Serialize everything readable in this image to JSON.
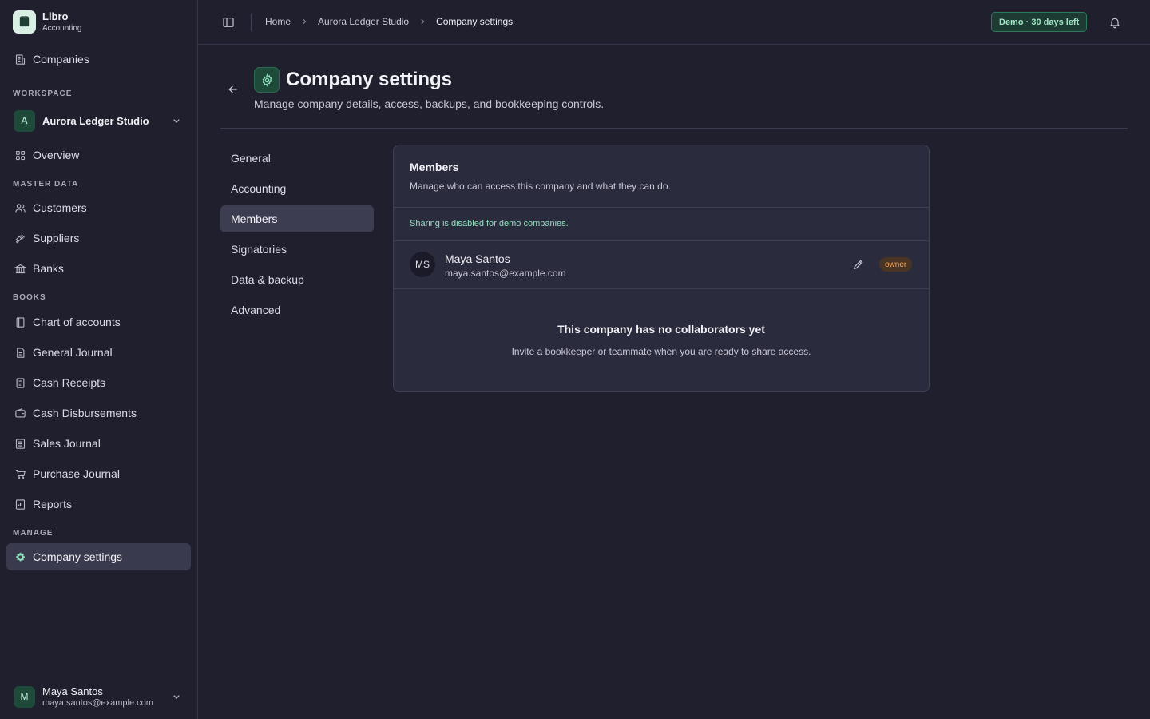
{
  "brand": {
    "name": "Libro",
    "subtitle": "Accounting"
  },
  "sidebar": {
    "companies_label": "Companies",
    "sections": {
      "workspace": "WORKSPACE",
      "master_data": "MASTER DATA",
      "books": "BOOKS",
      "manage": "MANAGE"
    },
    "workspace": {
      "initial": "A",
      "name": "Aurora Ledger Studio"
    },
    "items": [
      {
        "label": "Overview",
        "icon": "grid-icon"
      },
      {
        "label": "Customers",
        "icon": "users-icon"
      },
      {
        "label": "Suppliers",
        "icon": "truck-icon"
      },
      {
        "label": "Banks",
        "icon": "bank-icon"
      },
      {
        "label": "Chart of accounts",
        "icon": "book-icon"
      },
      {
        "label": "General Journal",
        "icon": "journal-icon"
      },
      {
        "label": "Cash Receipts",
        "icon": "receipt-icon"
      },
      {
        "label": "Cash Disbursements",
        "icon": "wallet-icon"
      },
      {
        "label": "Sales Journal",
        "icon": "list-icon"
      },
      {
        "label": "Purchase Journal",
        "icon": "cart-icon"
      },
      {
        "label": "Reports",
        "icon": "chart-icon"
      },
      {
        "label": "Company settings",
        "icon": "gear-icon"
      }
    ],
    "user": {
      "initial": "M",
      "name": "Maya Santos",
      "email": "maya.santos@example.com"
    }
  },
  "topbar": {
    "breadcrumbs": [
      "Home",
      "Aurora Ledger Studio",
      "Company settings"
    ],
    "demo_badge": "Demo · 30 days left"
  },
  "page": {
    "title": "Company settings",
    "subtitle": "Manage company details, access, backups, and bookkeeping controls."
  },
  "settings_nav": [
    "General",
    "Accounting",
    "Members",
    "Signatories",
    "Data & backup",
    "Advanced"
  ],
  "members_card": {
    "title": "Members",
    "description": "Manage who can access this company and what they can do.",
    "notice": "Sharing is disabled for demo companies.",
    "member": {
      "initials": "MS",
      "name": "Maya Santos",
      "email": "maya.santos@example.com",
      "role": "owner"
    },
    "empty_title": "This company has no collaborators yet",
    "empty_desc": "Invite a bookkeeper or teammate when you are ready to share access."
  },
  "colors": {
    "background": "#1f1f2e",
    "accent": "#8fe0bd",
    "owner_badge": "#f2a45a"
  }
}
